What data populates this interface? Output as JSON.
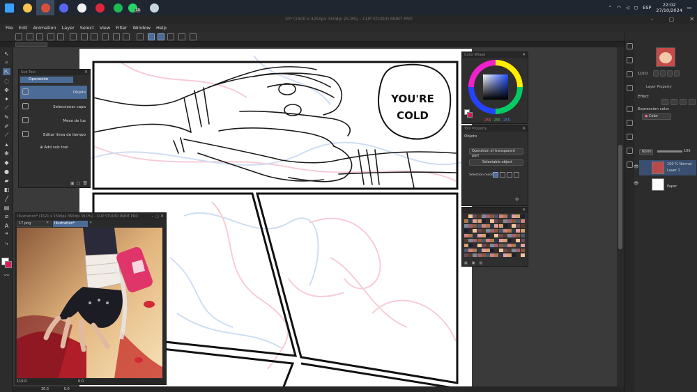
{
  "taskbar": {
    "apps": [
      {
        "name": "windows-start-icon",
        "color": "#3aa0ff"
      },
      {
        "name": "file-explorer-icon",
        "color": "#f2c14e"
      },
      {
        "name": "clip-studio-taskbar-icon",
        "color": "#d8503a"
      },
      {
        "name": "discord-icon",
        "color": "#5865f2"
      },
      {
        "name": "obs-icon",
        "color": "#f1f1f1"
      },
      {
        "name": "opera-icon",
        "color": "#e0263b"
      },
      {
        "name": "spotify-icon",
        "color": "#1db954"
      },
      {
        "name": "whatsapp-icon",
        "color": "#25d366"
      },
      {
        "name": "steam-icon",
        "color": "#c7d5e0"
      }
    ],
    "whatsapp_badge": "19",
    "language": "ESP",
    "time": "22:02",
    "date": "27/10/2024"
  },
  "window": {
    "title": "10* (1500 x 4250px 350dpi 25.9%) - CLIP STUDIO PAINT PRO"
  },
  "menu": [
    "File",
    "Edit",
    "Animation",
    "Layer",
    "Select",
    "View",
    "Filter",
    "Window",
    "Help"
  ],
  "subtool": {
    "header": "Sub Tool",
    "group_tab": "Operación",
    "items": [
      {
        "label": "Objeto",
        "icon": "object-select-icon",
        "selected": true
      },
      {
        "label": "Seleccionar capa",
        "icon": "select-layer-icon",
        "selected": false
      },
      {
        "label": "Mesa de luz",
        "icon": "light-table-icon",
        "selected": false
      },
      {
        "label": "Editar línea de tiempo",
        "icon": "timeline-edit-icon",
        "selected": false
      }
    ],
    "add_sub_tool": "Add sub tool"
  },
  "navigator": {
    "title": "Illustration* (1521 x 1500px 350dpi 39.0%) - CLIP STUDIO PAINT PRO",
    "tabs": [
      "17.png",
      "Illustration*"
    ],
    "zoom": "110.0",
    "rotation": "0.0"
  },
  "comic": {
    "bubble_text_line1": "YOU'RE",
    "bubble_text_line2": "COLD"
  },
  "color_wheel": {
    "title": "Color Wheel",
    "rgb": [
      "255",
      "255",
      "255"
    ],
    "main_color": "#ffffff",
    "sub_color": "#d81b60"
  },
  "tool_property": {
    "title": "Tool Property",
    "tool_name": "Objeto",
    "operation_dropdown": "Operation of transparent part",
    "selectable_dropdown": "Selectable object",
    "selection_mode_label": "Selection mode"
  },
  "layer_property": {
    "title": "Layer Property",
    "effect_label": "Effect",
    "expression_color_label": "Expression color",
    "expression_color_value": "Color"
  },
  "layers": {
    "blend_mode": "Norm",
    "opacity": "100",
    "items": [
      {
        "name": "Layer 1",
        "meta": "100 % Normal",
        "selected": true
      },
      {
        "name": "Paper",
        "meta": "",
        "selected": false
      }
    ]
  },
  "status": {
    "zoom": "30.5",
    "rotation": "0.0",
    "right_zoom": "110.0"
  }
}
